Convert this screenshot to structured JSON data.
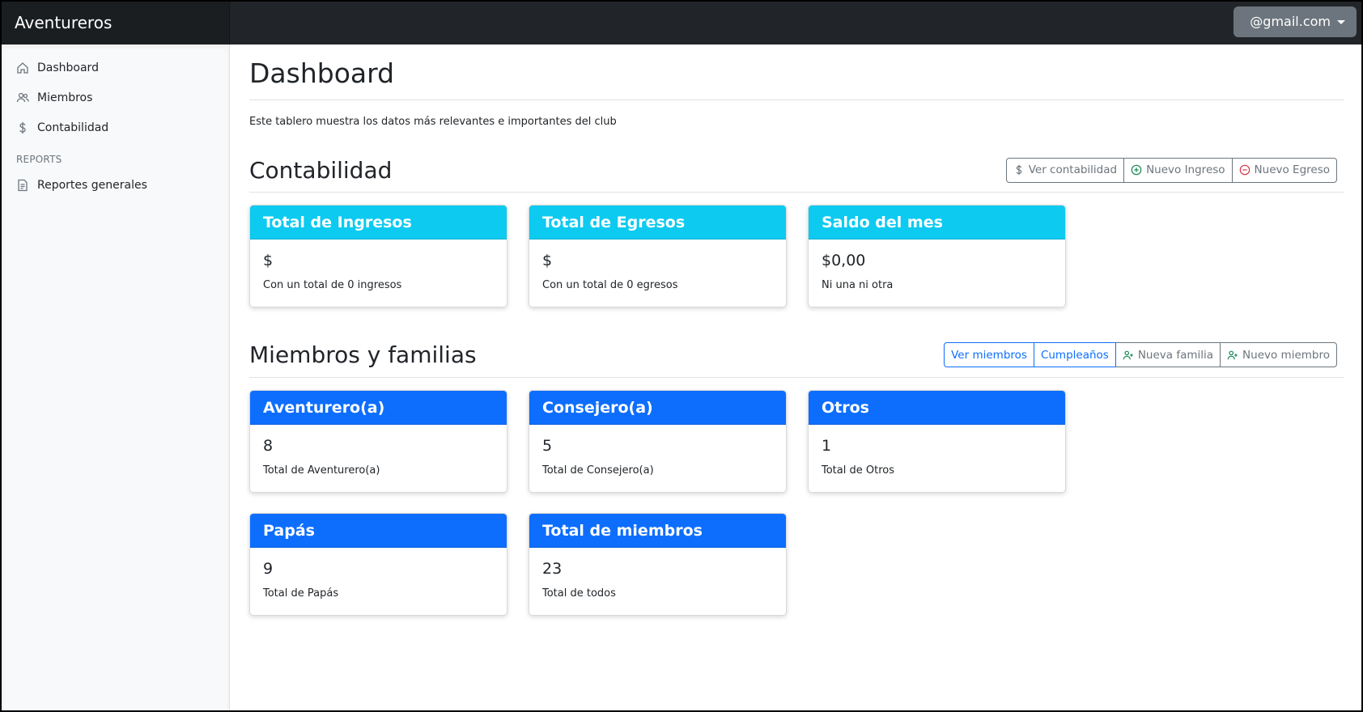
{
  "navbar": {
    "brand": "Aventureros",
    "user": "@gmail.com"
  },
  "sidebar": {
    "items": [
      {
        "label": "Dashboard",
        "icon": "home-icon"
      },
      {
        "label": "Miembros",
        "icon": "people-icon"
      },
      {
        "label": "Contabilidad",
        "icon": "dollar-icon"
      }
    ],
    "reports_heading": "REPORTS",
    "reports": [
      {
        "label": "Reportes generales",
        "icon": "file-text-icon"
      }
    ]
  },
  "page": {
    "title": "Dashboard",
    "description": "Este tablero muestra los datos más relevantes e importantes del club"
  },
  "contabilidad": {
    "title": "Contabilidad",
    "buttons": [
      {
        "label": "Ver contabilidad",
        "icon": "dollar-icon"
      },
      {
        "label": "Nuevo Ingreso",
        "icon": "plus-circle-icon"
      },
      {
        "label": "Nuevo Egreso",
        "icon": "minus-circle-icon"
      }
    ],
    "cards": [
      {
        "title": "Total de Ingresos",
        "value": "$",
        "text": "Con un total de 0 ingresos"
      },
      {
        "title": "Total de Egresos",
        "value": "$",
        "text": "Con un total de 0 egresos"
      },
      {
        "title": "Saldo del mes",
        "value": "$0,00",
        "text": "Ni una ni otra"
      }
    ]
  },
  "miembros": {
    "title": "Miembros y familias",
    "buttons": [
      {
        "label": "Ver miembros"
      },
      {
        "label": "Cumpleaños"
      },
      {
        "label": "Nueva familia",
        "icon": "person-plus-icon"
      },
      {
        "label": "Nuevo miembro",
        "icon": "person-plus-icon"
      }
    ],
    "cards": [
      {
        "title": "Aventurero(a)",
        "value": "8",
        "text": "Total de Aventurero(a)"
      },
      {
        "title": "Consejero(a)",
        "value": "5",
        "text": "Total de Consejero(a)"
      },
      {
        "title": "Otros",
        "value": "1",
        "text": "Total de Otros"
      },
      {
        "title": "Papás",
        "value": "9",
        "text": "Total de Papás"
      },
      {
        "title": "Total de miembros",
        "value": "23",
        "text": "Total de todos"
      }
    ]
  },
  "colors": {
    "info": "#0dcaf0",
    "primary": "#0d6efd",
    "success": "#198754",
    "danger": "#dc3545",
    "dark": "#212529"
  }
}
